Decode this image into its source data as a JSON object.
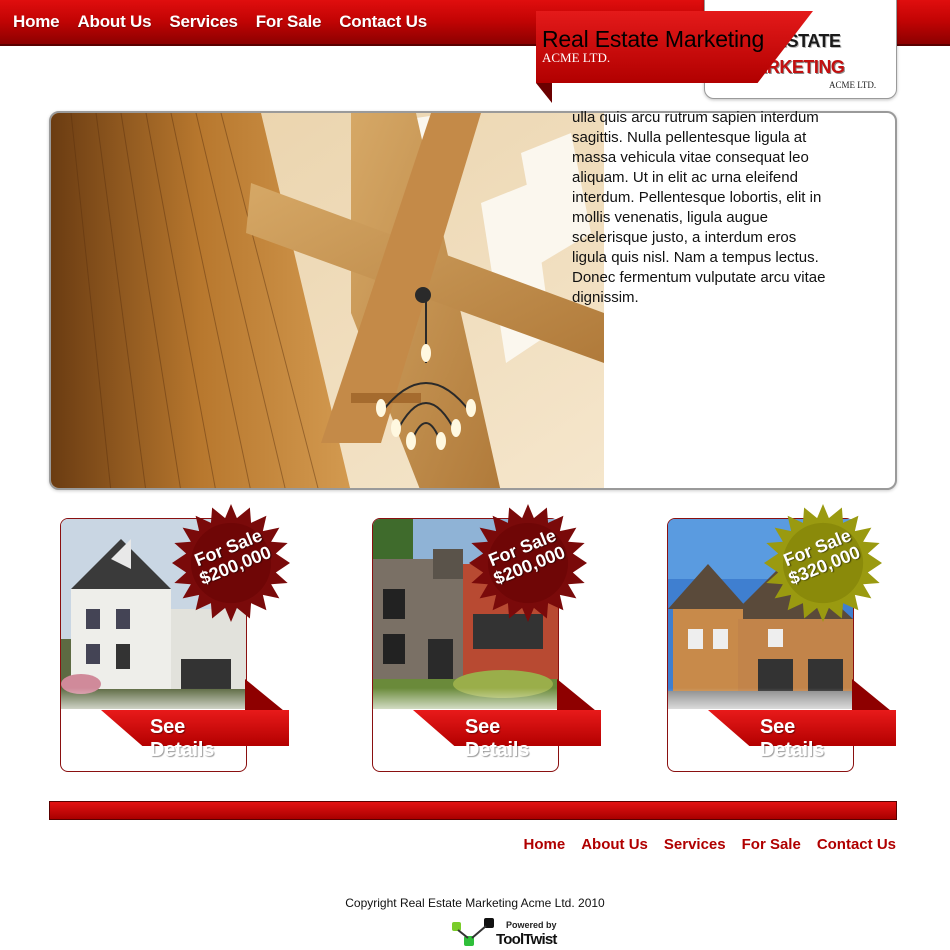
{
  "nav": {
    "items": [
      {
        "label": "Home"
      },
      {
        "label": "About Us"
      },
      {
        "label": "Services"
      },
      {
        "label": "For Sale"
      },
      {
        "label": "Contact Us"
      }
    ]
  },
  "logo": {
    "line1": "Real Estate",
    "line2": "Marketing",
    "line3": "ACME LTD."
  },
  "hero": {
    "title": "Real Estate Marketing",
    "subtitle": "ACME LTD.",
    "body": "ulla quis arcu rutrum sapien interdum sagittis. Nulla pellentesque ligula at massa vehicula vitae consequat leo aliquam. Ut in elit ac urna eleifend interdum. Pellentesque lobortis, elit in mollis venenatis, ligula augue scelerisque justo, a interdum eros ligula quis nisl. Nam a tempus lectus. Donec fermentum vulputate arcu vitae dignissim."
  },
  "listings": [
    {
      "badge_line1": "For Sale",
      "price": "$200,000",
      "button": "See Details",
      "badge_color": "#7a0a0a"
    },
    {
      "badge_line1": "For Sale",
      "price": "$200,000",
      "button": "See Details",
      "badge_color": "#7a0a0a"
    },
    {
      "badge_line1": "For Sale",
      "price": "$320,000",
      "button": "See Details",
      "badge_color": "#9a9a10"
    }
  ],
  "footer": {
    "nav": [
      {
        "label": "Home"
      },
      {
        "label": "About Us"
      },
      {
        "label": "Services"
      },
      {
        "label": "For Sale"
      },
      {
        "label": "Contact Us"
      }
    ],
    "copyright": "Copyright Real Estate Marketing Acme Ltd. 2010",
    "powered_by": "Powered by",
    "powered_brand": "ToolTwist"
  },
  "colors": {
    "primary_red": "#c40404",
    "dark_red": "#8c0000",
    "link_red": "#b00000"
  }
}
